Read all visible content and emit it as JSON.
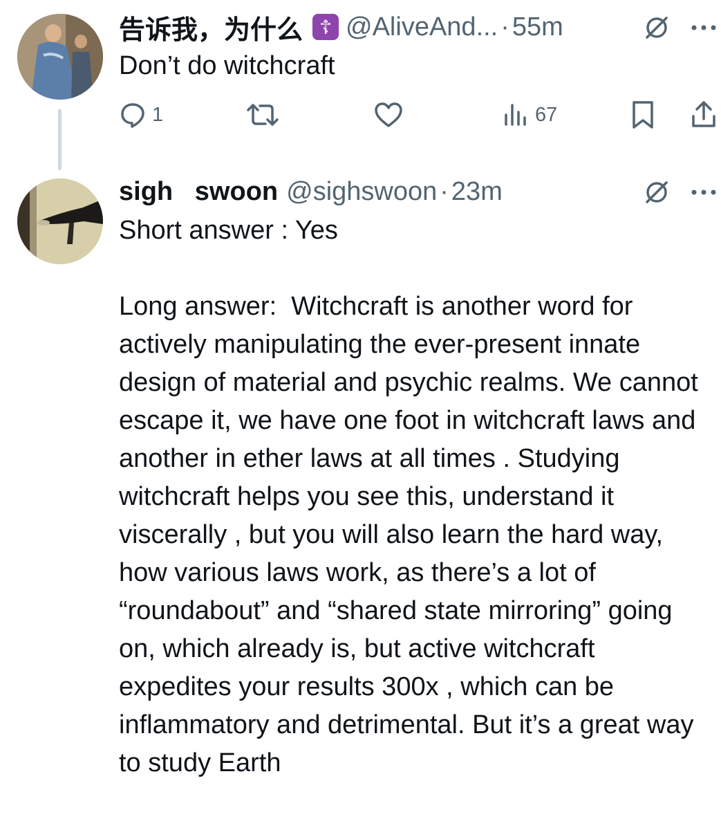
{
  "tweet1": {
    "display_name": "告诉我，为什么",
    "badge": "☦",
    "handle": "@AliveAnd...",
    "separator": "·",
    "time": "55m",
    "text": "Don’t do witchcraft",
    "reply_count": "1",
    "views_count": "67"
  },
  "tweet2": {
    "display_name": "sigh   swoon",
    "handle": "@sighswoon",
    "separator": "·",
    "time": "23m",
    "text": "Short answer : Yes\n\nLong answer:  Witchcraft is another word for actively manipulating the ever-present innate design of material and psychic realms. We cannot escape it, we have one foot in witchcraft laws and another in ether laws at all times . Studying witchcraft helps you see this, understand it viscerally , but you will also learn the hard way, how various laws work, as there’s a lot of “roundabout” and “shared state mirroring” going on, which already is, but active witchcraft expedites your results 300x , which can be inflammatory and detrimental. But it’s a great way to study Earth"
  },
  "colors": {
    "text": "#0f1419",
    "secondary": "#536471",
    "badge": "#8e44ad",
    "thread_line": "#cfd9de"
  },
  "icons": [
    "grok-icon",
    "more-icon",
    "reply-icon",
    "retweet-icon",
    "like-icon",
    "views-icon",
    "bookmark-icon",
    "share-icon"
  ]
}
